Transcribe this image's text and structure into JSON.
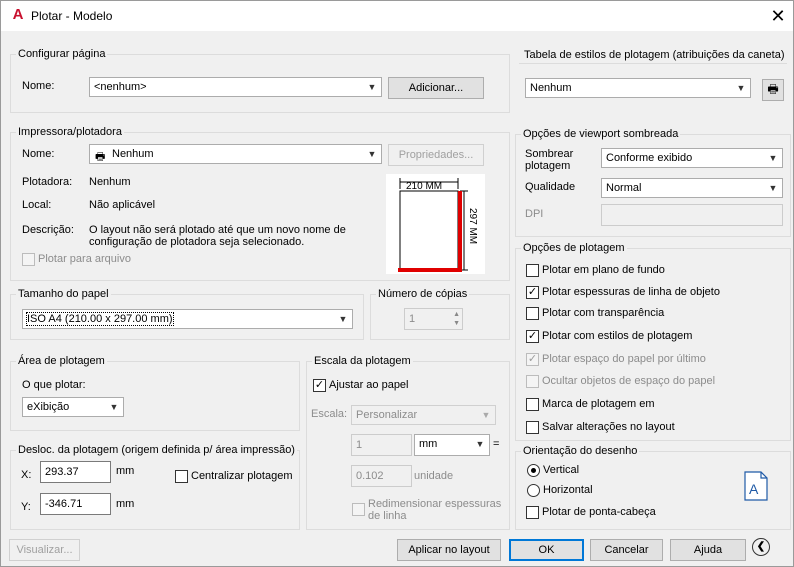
{
  "window": {
    "title": "Plotar - Modelo"
  },
  "page_setup": {
    "group": "Configurar página",
    "name_label": "Nome:",
    "name_value": "<nenhum>",
    "add_button": "Adicionar..."
  },
  "printer": {
    "group": "Impressora/plotadora",
    "name_label": "Nome:",
    "name_value": "Nenhum",
    "properties_button": "Propriedades...",
    "plotter_label": "Plotadora:",
    "plotter_value": "Nenhum",
    "location_label": "Local:",
    "location_value": "Não aplicável",
    "description_label": "Descrição:",
    "description_line1": "O layout não será plotado até que um novo nome de",
    "description_line2": "configuração de plotadora seja selecionado.",
    "plot_to_file": "Plotar para arquivo",
    "preview_width": "210 MM",
    "preview_height": "297 MM"
  },
  "paper_size": {
    "group": "Tamanho do papel",
    "value": "ISO A4 (210.00 x 297.00 mm)"
  },
  "copies": {
    "group": "Número de cópias",
    "value": "1"
  },
  "plot_area": {
    "group": "Área de plotagem",
    "what_label": "O que plotar:",
    "what_value": "eXibição"
  },
  "plot_offset": {
    "group": "Desloc. da plotagem (origem definida p/ área impressão)",
    "x_label": "X:",
    "x_value": "293.37",
    "x_unit": "mm",
    "y_label": "Y:",
    "y_value": "-346.71",
    "y_unit": "mm",
    "center": "Centralizar plotagem"
  },
  "plot_scale": {
    "group": "Escala da plotagem",
    "fit": "Ajustar ao papel",
    "scale_label": "Escala:",
    "scale_value": "Personalizar",
    "value1": "1",
    "unit1": "mm",
    "equals": "=",
    "value2": "0.102",
    "unit2": "unidade",
    "rescale_line1": "Redimensionar espessuras",
    "rescale_line2": "de linha"
  },
  "style_table": {
    "group": "Tabela de estilos de plotagem (atribuições da caneta)",
    "value": "Nenhum"
  },
  "shaded": {
    "group": "Opções de viewport sombreada",
    "shade_label1": "Sombrear",
    "shade_label2": "plotagem",
    "shade_value": "Conforme exibido",
    "quality_label": "Qualidade",
    "quality_value": "Normal",
    "dpi_label": "DPI"
  },
  "plot_options": {
    "group": "Opções de plotagem",
    "items": [
      "Plotar em plano de fundo",
      "Plotar espessuras de linha de objeto",
      "Plotar com transparência",
      "Plotar com estilos de plotagem",
      "Plotar espaço do papel por último",
      "Ocultar objetos de espaço do papel",
      "Marca de plotagem em",
      "Salvar alterações no layout"
    ]
  },
  "orientation": {
    "group": "Orientação do desenho",
    "portrait": "Vertical",
    "landscape": "Horizontal",
    "upside_down": "Plotar de ponta-cabeça",
    "icon_letter": "A"
  },
  "footer": {
    "preview": "Visualizar...",
    "apply": "Aplicar no layout",
    "ok": "OK",
    "cancel": "Cancelar",
    "help": "Ajuda"
  }
}
